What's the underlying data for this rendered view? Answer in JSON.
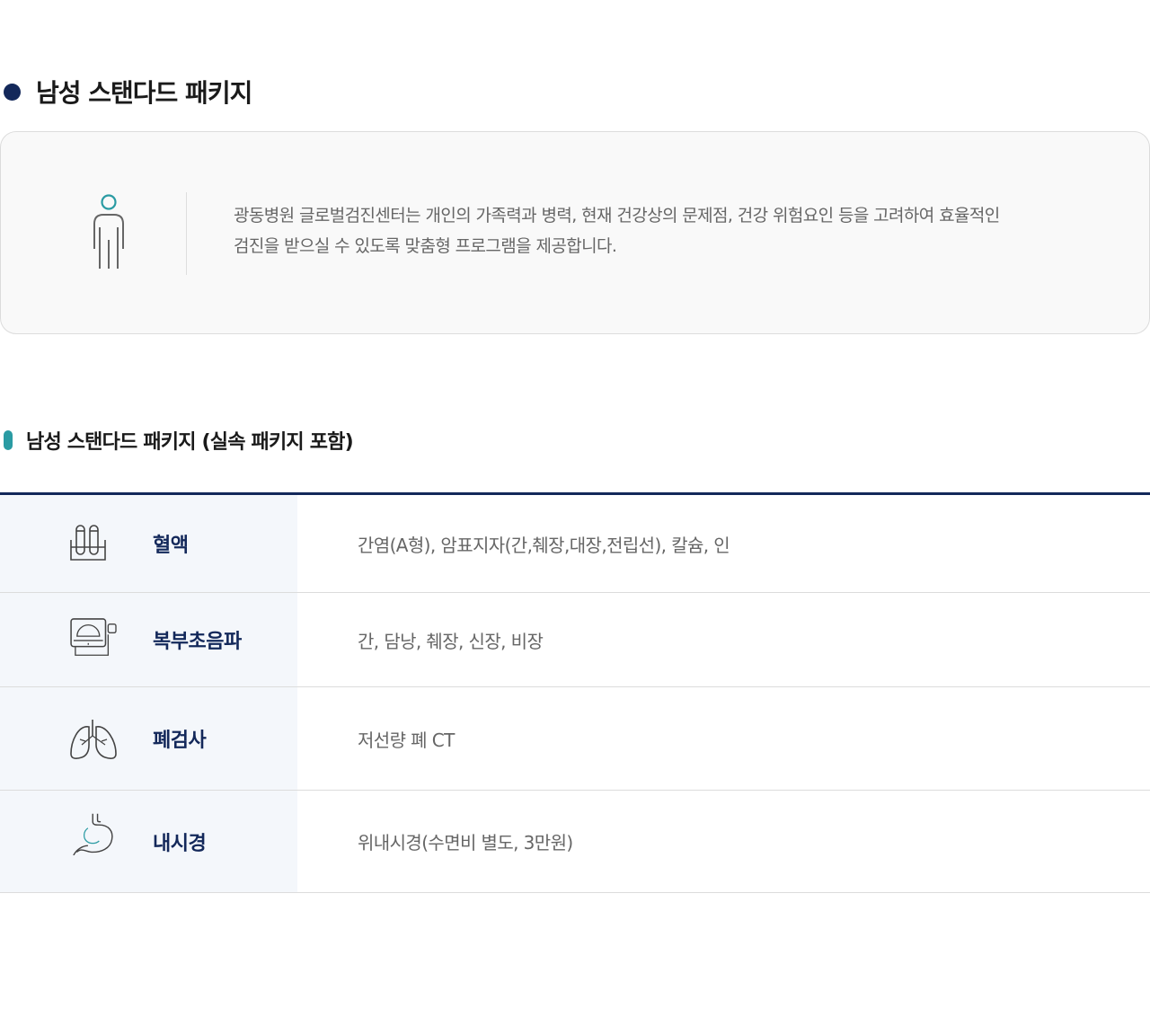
{
  "section": {
    "title": "남성 스탠다드 패키지"
  },
  "intro": {
    "icon": "person-icon",
    "line1": "광동병원 글로벌검진센터는 개인의 가족력과 병력, 현재 건강상의 문제점, 건강 위험요인 등을 고려하여 효율적인",
    "line2": "검진을 받으실 수 있도록 맞춤형 프로그램을 제공합니다."
  },
  "package": {
    "title": "남성 스탠다드 패키지 (실속 패키지 포함)"
  },
  "table": {
    "rows": [
      {
        "icon": "test-tube-icon",
        "label": "혈액",
        "value": "간염(A형), 암표지자(간,췌장,대장,전립선), 칼슘, 인"
      },
      {
        "icon": "ultrasound-icon",
        "label": "복부초음파",
        "value": "간, 담낭, 췌장, 신장, 비장"
      },
      {
        "icon": "lungs-icon",
        "label": "폐검사",
        "value": "저선량 폐 CT"
      },
      {
        "icon": "stomach-icon",
        "label": "내시경",
        "value": "위내시경(수면비 별도, 3만원)"
      }
    ]
  },
  "colors": {
    "navy": "#13285a",
    "teal": "#2a9ba3",
    "header_bg": "#f4f7fb"
  }
}
